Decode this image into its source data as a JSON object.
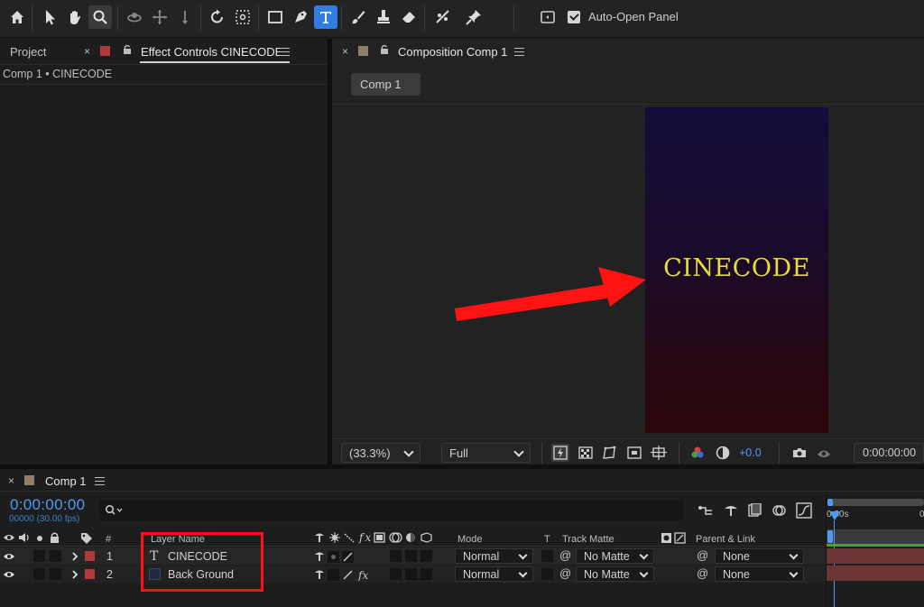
{
  "toolbar": {
    "auto_open_label": "Auto-Open Panel",
    "auto_open_checked": true,
    "active_tool": "type-tool"
  },
  "left_panel": {
    "tab_project": "Project",
    "tab_effect_controls": "Effect Controls CINECODE",
    "breadcrumb": "Comp 1 • CINECODE"
  },
  "viewer": {
    "tab_title": "Composition Comp 1",
    "comp_button": "Comp 1",
    "canvas_text": "CINECODE",
    "zoom": "(33.3%)",
    "resolution": "Full",
    "exposure": "+0.0",
    "timecode": "0:00:00:00"
  },
  "timeline": {
    "tab_title": "Comp 1",
    "current_time": "0:00:00:00",
    "frame_info": "00000 (30.00 fps)",
    "search_placeholder": "",
    "columns": {
      "number": "#",
      "layer_name": "Layer Name",
      "mode": "Mode",
      "t": "T",
      "track_matte": "Track Matte",
      "parent_link": "Parent & Link"
    },
    "ruler_label": "0:00s",
    "ruler_label_end": "0",
    "layers": [
      {
        "number": "1",
        "name": "CINECODE",
        "type_glyph": "T",
        "mode": "Normal",
        "track_matte": "No Matte",
        "parent": "None",
        "label_color": "#b03a3a"
      },
      {
        "number": "2",
        "name": "Back Ground",
        "type_glyph": "",
        "mode": "Normal",
        "track_matte": "No Matte",
        "parent": "None",
        "label_color": "#b03a3a"
      }
    ]
  },
  "colors": {
    "accent_blue": "#2f7de1",
    "timecode_blue": "#4e9bf5",
    "canvas_text": "#e8dc3c",
    "annotation_red": "#ff1212"
  }
}
